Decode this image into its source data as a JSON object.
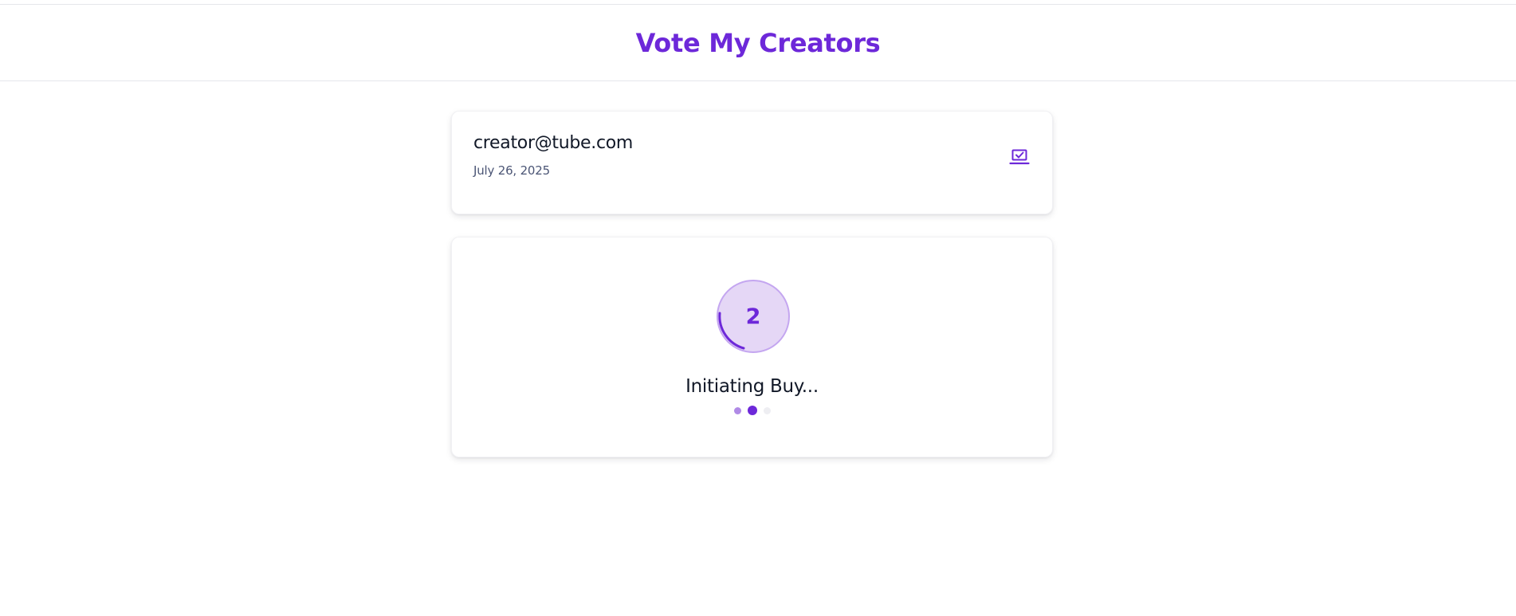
{
  "header": {
    "title": "Vote My Creators"
  },
  "account": {
    "email": "creator@tube.com",
    "date": "July 26, 2025",
    "action_icon": "laptop-check-icon"
  },
  "process": {
    "step_number": "2",
    "status": "Initiating Buy...",
    "active_step_index": 2,
    "total_steps": 3
  },
  "colors": {
    "accent": "#6d28d9",
    "accent_light": "#e5d7f6",
    "muted_text": "#4b5575"
  }
}
